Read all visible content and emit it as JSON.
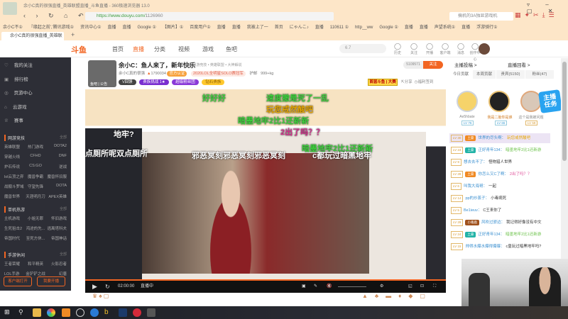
{
  "browser": {
    "title": "余小C真的很强直播_英雄联盟直播_斗鱼直播 - 360极速浏览器 13.0",
    "url_host": "https://www.douyu.com/",
    "url_path": "1126960",
    "search_placeholder": "搞机的3A独显游戏机",
    "bookmarks": [
      "余小C不①",
      "『缘起之前','腾讯游戏①",
      "资讯中心①",
      "直播",
      "直播",
      "Google ①",
      "【图片】①",
      "百度用户①",
      "直播",
      "直播",
      "我被上了一",
      "首页",
      "にゃんこ♪",
      "直播",
      "110611 ①",
      "http__ww",
      "Google ①",
      "直播",
      "直播",
      "声望系统①",
      "直播",
      "浮游骑行①"
    ],
    "tab": "余小C真的很强直播_英雄联盟直",
    "nav": "‹ › ↻ ⌂ ↶ ☆"
  },
  "header": {
    "logo": "斗鱼",
    "nav": [
      "首页",
      "直播",
      "分类",
      "视频",
      "游戏",
      "鱼吧"
    ],
    "search_placeholder": "6.7",
    "icons": [
      {
        "icon": "history-icon",
        "label": "历史"
      },
      {
        "icon": "heart-icon",
        "label": "关注"
      },
      {
        "icon": "broadcast-icon",
        "label": "开播"
      },
      {
        "icon": "client-icon",
        "label": "客户端"
      },
      {
        "icon": "message-icon",
        "label": "消息"
      },
      {
        "icon": "creator-icon",
        "label": "创作中心"
      }
    ]
  },
  "sidebar": {
    "items": [
      "我的关注",
      "排行榜",
      "页游中心",
      "云游戏",
      "赛事"
    ],
    "sections": [
      {
        "title": "网游竞技",
        "more": "全部",
        "games": [
          "英雄联盟",
          "热门游戏",
          "DOTA2",
          "穿越火线",
          "CFHD",
          "DNF",
          "炉石传说",
          "CS:GO",
          "逆战",
          "lol云顶之弈",
          "魔兽争霸",
          "魔兽怀旧服",
          "战舰斗罗域",
          "守望先锋",
          "DOTA",
          "魔兽世界",
          "天涯明月刀",
          "APEX英雄"
        ]
      },
      {
        "title": "单机热游",
        "more": "全部",
        "games": [
          "主机游戏",
          "小姐无罪",
          "怀旧游戏",
          "生死狙击2",
          "鸿途的先...",
          "逃离塔科夫",
          "帝国时代",
          "至死方休...",
          "帝国神话"
        ]
      },
      {
        "title": "手游休闲",
        "more": "全部",
        "games": [
          "王者荣耀",
          "和平精英",
          "火影忍者",
          "LOL手游",
          "金铲铲之战",
          "幻唐"
        ]
      }
    ],
    "buttons": [
      "客户端打开",
      "我要开播"
    ]
  },
  "room": {
    "title": "余小C：鱼人来了，新年快乐",
    "tag": "举报",
    "category": "网游竞技 • 英雄联盟 • 大神解说",
    "streamer": "余小C真的很强",
    "heat": "1790034",
    "verify": "官方认证",
    "honor": "2020LOL全明星SOLO赛冠军",
    "fan_badge_sub": "护邮",
    "weight": "999+kg",
    "badges": [
      "V回馈",
      "贵族挑战 1★",
      "超级粉丝团",
      "钻石贵族"
    ],
    "fans": "5109571",
    "follow": "关注",
    "promo": "首届斗鱼 | 大赛",
    "share": "分享",
    "welfare": "福利签到",
    "avatar_caption": "鱼吧 | 公告"
  },
  "danmaku": [
    {
      "t": "好好好",
      "c": "#3dd13d"
    },
    {
      "t": "速度撤是死了一乱",
      "c": "#3dd13d"
    },
    {
      "t": "玩您戒然酸吧",
      "c": "#e6a600"
    },
    {
      "t": "暗墨地牢2比1还新新",
      "c": "#3dd13d"
    },
    {
      "t": "2出了吗？？",
      "c": "#d0308a"
    },
    {
      "t": "地牢?",
      "c": "#ffffff"
    },
    {
      "t": "点厕所呢双点厕所",
      "c": "#ffffff"
    },
    {
      "t": "暗墨地牢2比1还新新",
      "c": "#3dd13d"
    },
    {
      "t": "邪恶冥刻邪恶冥刻邪恶冥刻",
      "c": "#ffffff"
    },
    {
      "t": "c都玩过暗黑地牢",
      "c": "#ffffff"
    }
  ],
  "player": {
    "time": "02:00:00",
    "quality": "直播中"
  },
  "right": {
    "links": [
      "主播投稿 >",
      "直播回看 >"
    ],
    "tabs": [
      "今日贡献",
      "本周贡献",
      "贵宾(5150)",
      "粉丝(47)"
    ],
    "top3": [
      {
        "name": "Ae5hbate",
        "lv": "LV 76"
      },
      {
        "name": "我是二胎你是谁",
        "lv": "LV 65"
      },
      {
        "name": "这个是我被问题",
        "lv": "LV 59"
      }
    ],
    "chat": [
      {
        "lv": "LV 30",
        "badge": "土豪",
        "bc": "#f08a24",
        "user": "世界的尽头啊：",
        "text": "玩您戒然酸吧",
        "tc": "#e6a600"
      },
      {
        "lv": "LV 24",
        "badge": "土豪",
        "bc": "#22b3a7",
        "user": "正好青年134：",
        "text": "暗墨地牢2比1还新游",
        "tc": "#6cc24a"
      },
      {
        "lv": "LV 9",
        "badge": "",
        "bc": "",
        "user": "想去去不了：",
        "text": "怪物猎人世界",
        "tc": "#333"
      },
      {
        "lv": "LV 28",
        "badge": "土豪",
        "bc": "#f08a24",
        "user": "你怎么又C了啊：",
        "text": "2出了吗？？",
        "tc": "#e0509a"
      },
      {
        "lv": "LV 6",
        "badge": "",
        "bc": "",
        "user": "叫我大海哥：",
        "text": "一起",
        "tc": "#333"
      },
      {
        "lv": "LV 14",
        "badge": "",
        "bc": "",
        "user": "pp的炒蒸子：",
        "text": "小毒病死",
        "tc": "#333"
      },
      {
        "lv": "LV 5",
        "badge": "",
        "bc": "",
        "user": "Be1ieuv：",
        "text": "C王来你了",
        "tc": "#333"
      },
      {
        "lv": "LV 29",
        "badge": "小毒鹿",
        "bc": "#a0521e",
        "user": "风吹过骄边：",
        "text": "我记得好像没有中文",
        "tc": "#333"
      },
      {
        "lv": "LV 24",
        "badge": "土豪",
        "bc": "#22b3a7",
        "user": "正好青年134：",
        "text": "暗墨地牢2比1还新游",
        "tc": "#6cc24a"
      },
      {
        "lv": "LV 15",
        "badge": "",
        "bc": "",
        "user": "帅得水爆水爆得爆爆：",
        "text": "c皇玩过暗黑地牢吗?",
        "tc": "#333"
      }
    ]
  }
}
